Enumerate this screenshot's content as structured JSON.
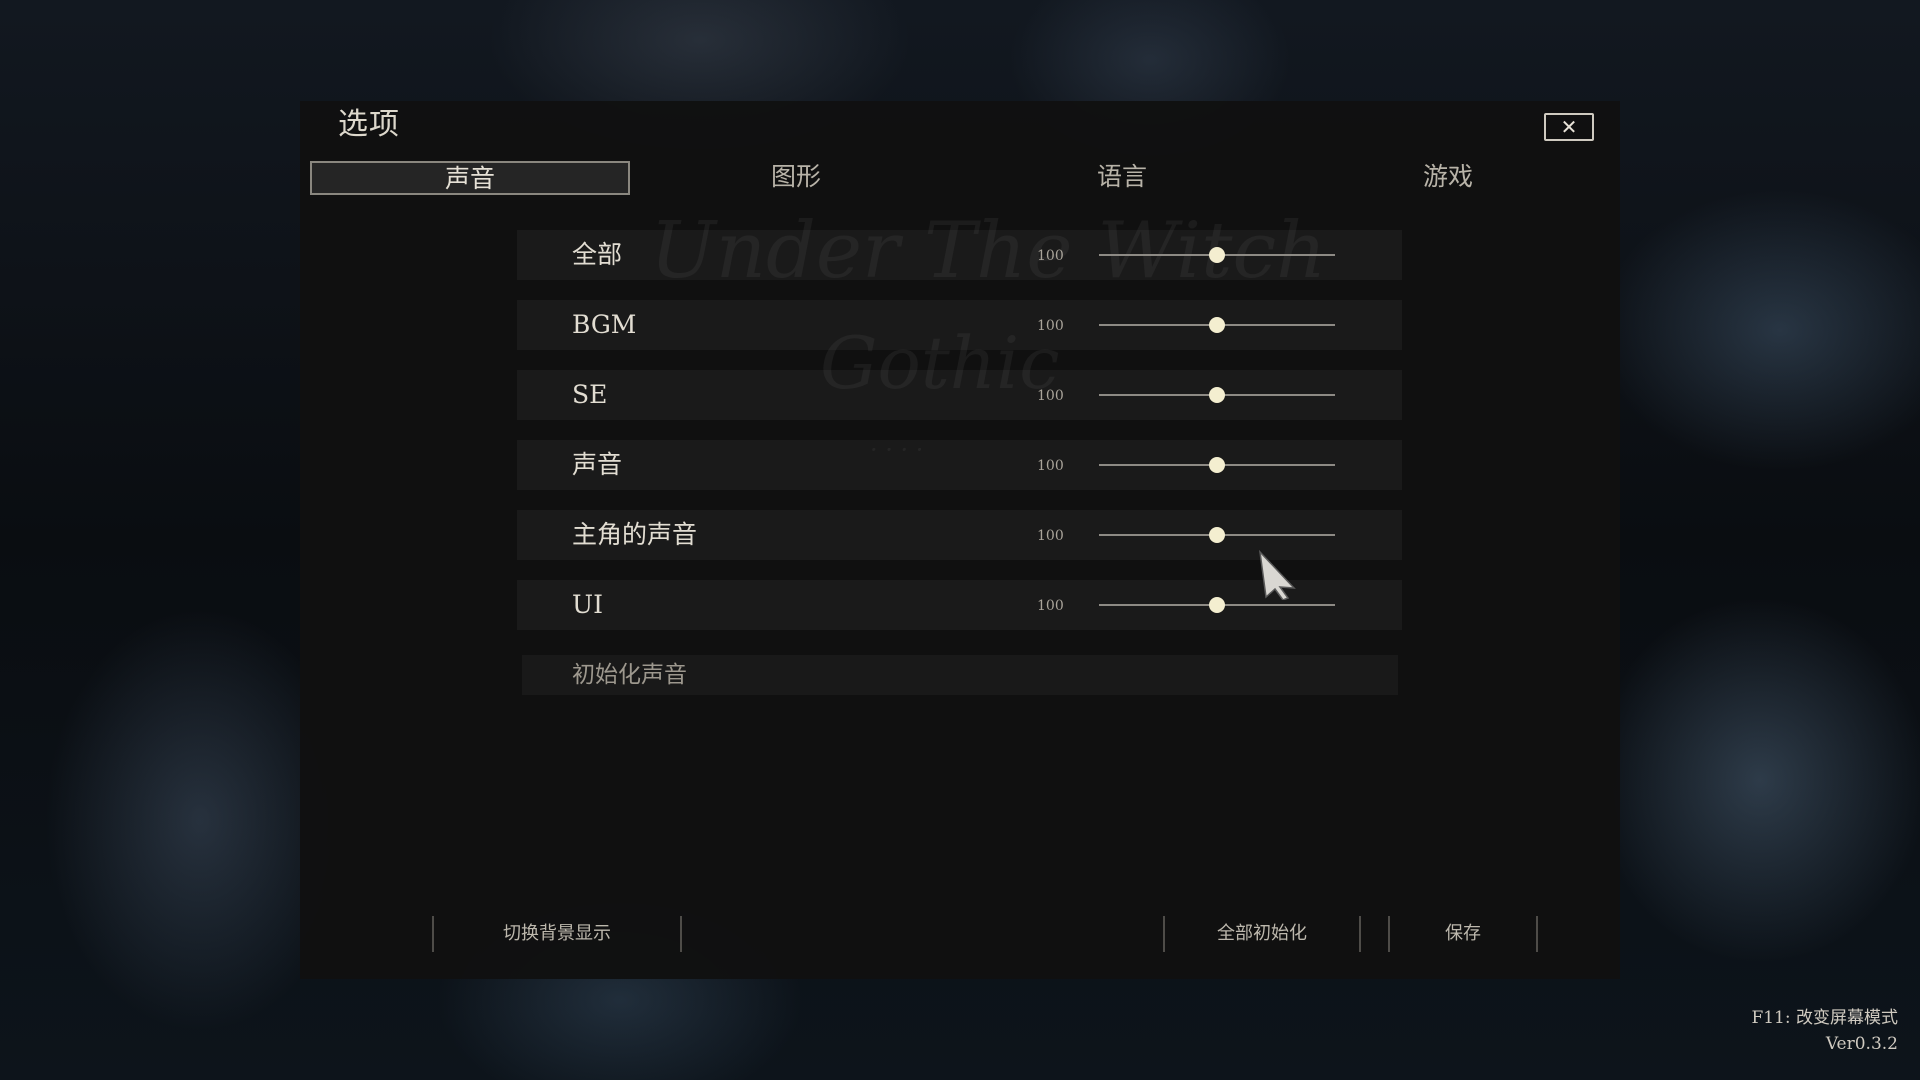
{
  "dialog": {
    "title": "选项",
    "close_icon": "close-x-icon"
  },
  "tabs": [
    {
      "label": "声音",
      "active": true
    },
    {
      "label": "图形",
      "active": false
    },
    {
      "label": "语言",
      "active": false
    },
    {
      "label": "游戏",
      "active": false
    }
  ],
  "sound_settings": [
    {
      "label": "全部",
      "value": "100",
      "level": 0.5
    },
    {
      "label": "BGM",
      "value": "100",
      "level": 0.5
    },
    {
      "label": "SE",
      "value": "100",
      "level": 0.5
    },
    {
      "label": "声音",
      "value": "100",
      "level": 0.5
    },
    {
      "label": "主角的声音",
      "value": "100",
      "level": 0.5
    },
    {
      "label": "UI",
      "value": "100",
      "level": 0.5
    }
  ],
  "reset_sound_label": "初始化声音",
  "footer": {
    "toggle_bg_label": "切换背景显示",
    "reset_all_label": "全部初始化",
    "save_label": "保存"
  },
  "overlay": {
    "screen_mode_hint": "F11: 改变屏幕模式",
    "version": "Ver0.3.2"
  },
  "colors": {
    "panel_bg": "#111111",
    "thumb": "#f4eed0",
    "text": "#e2ddd2"
  }
}
